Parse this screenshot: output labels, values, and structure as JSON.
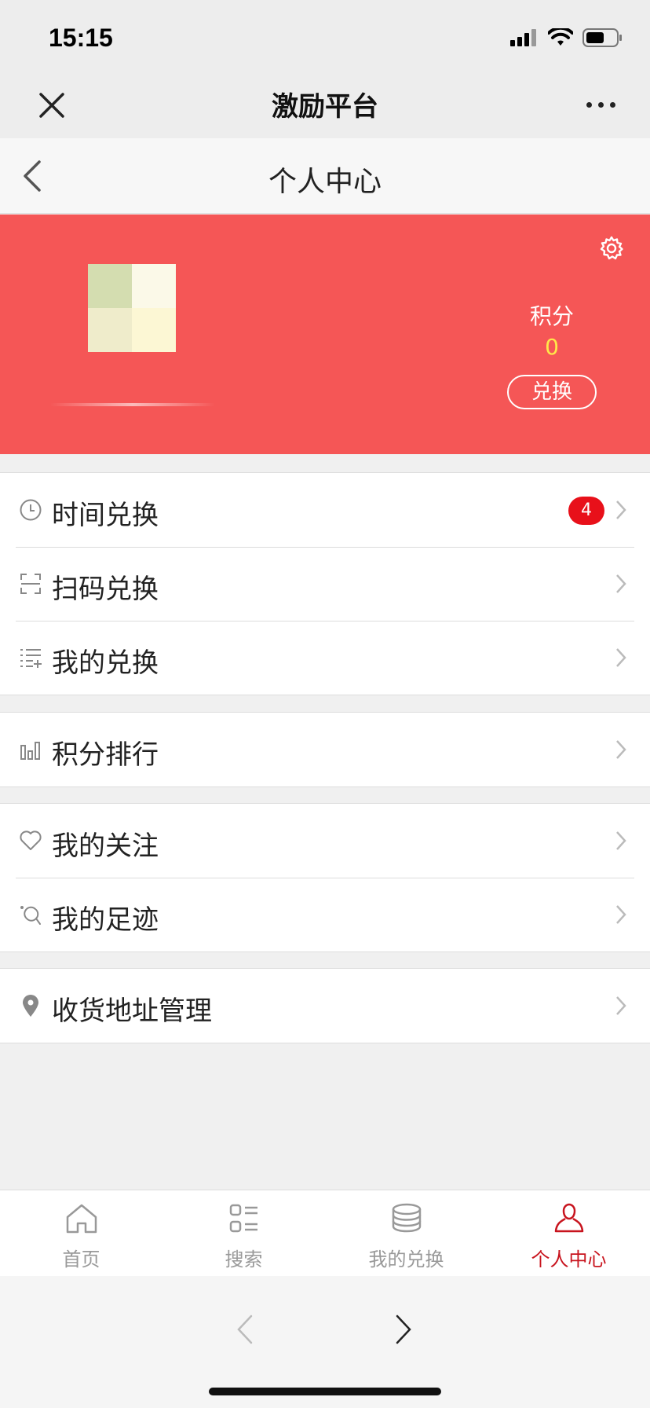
{
  "status_bar": {
    "time": "15:15"
  },
  "wechat_nav": {
    "title": "激励平台"
  },
  "header": {
    "title": "个人中心"
  },
  "profile": {
    "points_label": "积分",
    "points_value": "0",
    "redeem_label": "兑换"
  },
  "groups": [
    {
      "items": [
        {
          "icon": "clock-icon",
          "label": "时间兑换",
          "badge": "4"
        },
        {
          "icon": "scan-icon",
          "label": "扫码兑换"
        },
        {
          "icon": "list-add-icon",
          "label": "我的兑换"
        }
      ]
    },
    {
      "items": [
        {
          "icon": "bar-chart-icon",
          "label": "积分排行"
        }
      ]
    },
    {
      "items": [
        {
          "icon": "heart-icon",
          "label": "我的关注"
        },
        {
          "icon": "footprint-icon",
          "label": "我的足迹"
        }
      ]
    },
    {
      "items": [
        {
          "icon": "location-pin-icon",
          "label": "收货地址管理"
        }
      ]
    }
  ],
  "tabs": [
    {
      "icon": "home-icon",
      "label": "首页",
      "active": false
    },
    {
      "icon": "search-list-icon",
      "label": "搜索",
      "active": false
    },
    {
      "icon": "coins-icon",
      "label": "我的兑换",
      "active": false
    },
    {
      "icon": "person-icon",
      "label": "个人中心",
      "active": true
    }
  ],
  "colors": {
    "banner": "#f55656",
    "points_value": "#ffe84a",
    "badge": "#e8101a",
    "active_tab": "#c8141e"
  }
}
